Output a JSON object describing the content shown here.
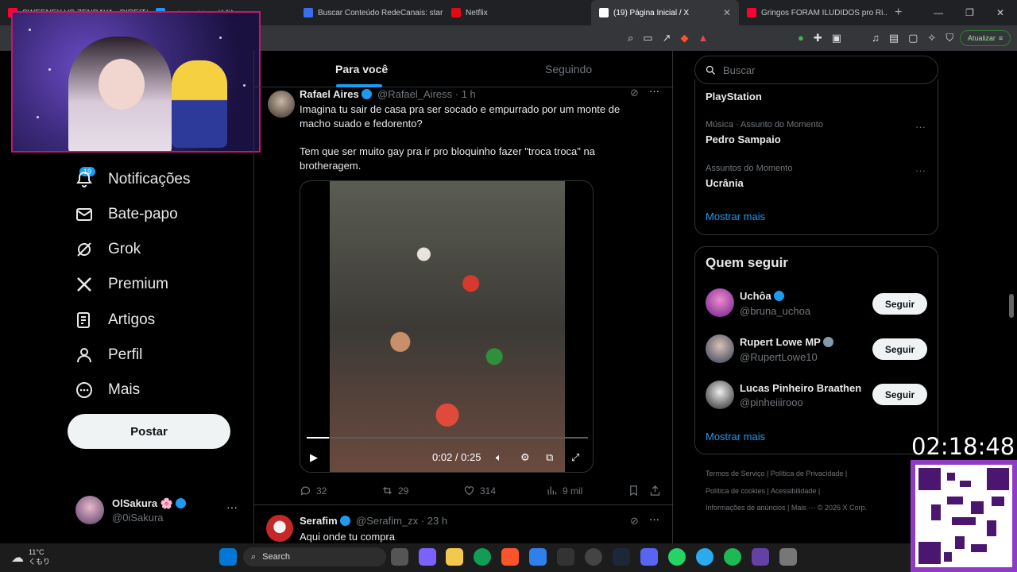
{
  "browser": {
    "tabs": [
      {
        "title": "SWEENEY VS ZENDAYA - DIREITA...",
        "color": "#ff0033"
      },
      {
        "title": "Prime Video: 地獄",
        "color": "#1a98ff"
      },
      {
        "title": "Buscar Conteúdo RedeCanais: star",
        "color": "#3c6df0"
      },
      {
        "title": "Netflix",
        "color": "#e50914"
      },
      {
        "title": "(19) Página Inicial / X",
        "color": "#ffffff"
      },
      {
        "title": "Gringos FORAM ILUDIDOS pro Ri...",
        "color": "#ff0033"
      }
    ],
    "update_label": "Atualizar"
  },
  "nav": {
    "notifications_badge": "19",
    "items": [
      {
        "label": "Notificações"
      },
      {
        "label": "Bate-papo"
      },
      {
        "label": "Grok"
      },
      {
        "label": "Premium"
      },
      {
        "label": "Artigos"
      },
      {
        "label": "Perfil"
      },
      {
        "label": "Mais"
      }
    ],
    "post_label": "Postar",
    "account": {
      "name": "OlSakura 🌸",
      "handle": "@0iSakura"
    }
  },
  "feed": {
    "tabs": [
      {
        "label": "Para você"
      },
      {
        "label": "Seguindo"
      }
    ],
    "tweets": [
      {
        "name": "Rafael Aires",
        "handle": "@Rafael_Airess",
        "time": "· 1 h",
        "text1": "Imagina tu sair de casa pra ser socado e empurrado por um monte de macho suado e fedorento?",
        "text2": "Tem que ser muito gay pra ir pro bloquinho fazer \"troca troca\" na brotheragem.",
        "video_time": "0:02 / 0:25",
        "video_progress": 0.08,
        "replies": "32",
        "reposts": "29",
        "likes": "314",
        "views": "9 mil"
      },
      {
        "name": "Serafim",
        "handle": "@Serafim_zx",
        "time": "· 23 h",
        "text1": "Aqui onde tu compra"
      }
    ]
  },
  "sidebar": {
    "search_placeholder": "Buscar",
    "trends": [
      {
        "category": "",
        "name": "PlayStation"
      },
      {
        "category": "Música · Assunto do Momento",
        "name": "Pedro Sampaio"
      },
      {
        "category": "Assuntos do Momento",
        "name": "Ucrânia"
      }
    ],
    "show_more": "Mostrar mais",
    "who_to_follow_title": "Quem seguir",
    "who_to_follow": [
      {
        "name": "Uchôa",
        "handle": "@bruna_uchoa",
        "button": "Seguir"
      },
      {
        "name": "Rupert Lowe MP",
        "handle": "@RupertLowe10",
        "button": "Seguir"
      },
      {
        "name": "Lucas Pinheiro Braathen",
        "handle": "@pinheiiirooo",
        "button": "Seguir"
      }
    ],
    "show_more_2": "Mostrar mais",
    "footer_line1": "Termos de Serviço  |  Política de Privacidade  |",
    "footer_line2": "Política de cookies  |  Acessibilidade  |",
    "footer_line3": "Informações de anúncios  |  Mais ···  © 2026 X Corp."
  },
  "overlay": {
    "clock": "02:18:48"
  },
  "taskbar": {
    "weather_temp": "11°C",
    "weather_desc": "くもり",
    "search_label": "Search"
  }
}
